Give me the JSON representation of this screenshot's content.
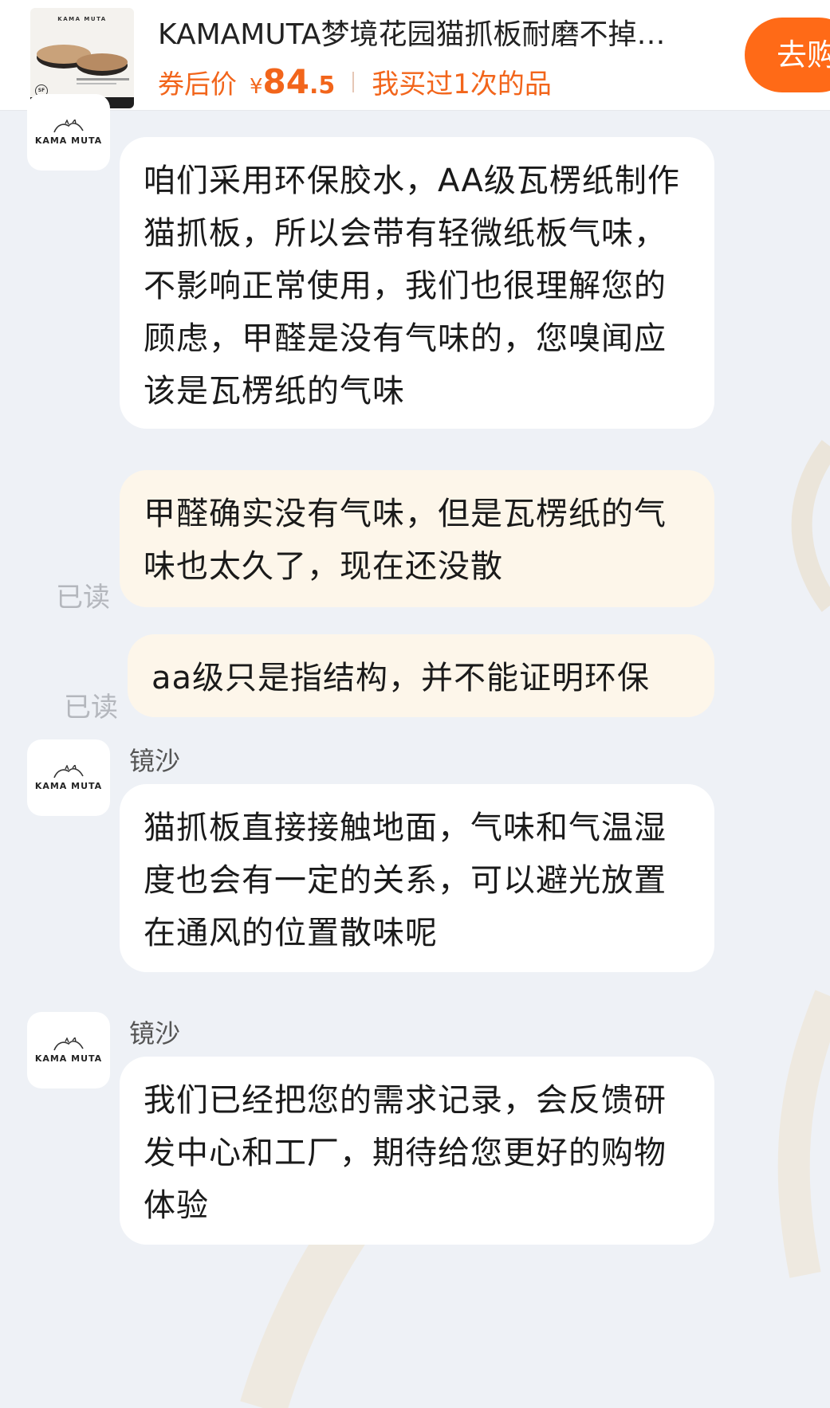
{
  "product": {
    "thumb_brand": "KAMA MUTA",
    "thumb_sf": "SF",
    "title": "KAMAMUTA梦境花园猫抓板耐磨不掉…",
    "price_label": "券后价",
    "price_currency": "¥",
    "price_int": "84",
    "price_dec": ".5",
    "purchase_note": "我买过1次的品",
    "goto_button": "去购"
  },
  "colors": {
    "accent": "#ff6a17",
    "price": "#f2651b",
    "incoming_bubble": "#ffffff",
    "outgoing_bubble": "#fdf6ea",
    "background": "#eef1f6"
  },
  "messages": [
    {
      "sender": "镜沙",
      "avatar_text": "KAMA MUTA",
      "text": "咱们采用环保胶水，AA级瓦楞纸制作猫抓板，所以会带有轻微纸板气味，不影响正常使用，我们也很理解您的顾虑，甲醛是没有气味的，您嗅闻应该是瓦楞纸的气味"
    },
    {
      "text": "甲醛确实没有气味，但是瓦楞纸的气味也太久了，现在还没散",
      "status": "已读"
    },
    {
      "text": "aa级只是指结构，并不能证明环保",
      "status": "已读"
    },
    {
      "sender": "镜沙",
      "avatar_text": "KAMA MUTA",
      "text": "猫抓板直接接触地面，气味和气温湿度也会有一定的关系，可以避光放置在通风的位置散味呢"
    },
    {
      "sender": "镜沙",
      "avatar_text": "KAMA MUTA",
      "text": "我们已经把您的需求记录，会反馈研发中心和工厂，期待给您更好的购物体验"
    }
  ]
}
